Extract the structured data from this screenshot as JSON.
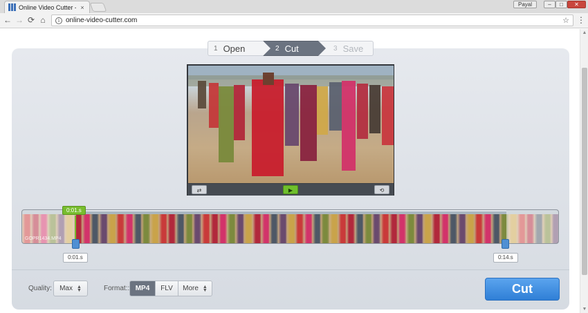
{
  "browser": {
    "tab_title": "Online Video Cutter - Cu",
    "tab_close": "×",
    "user_name": "Payal",
    "window_minimize": "–",
    "window_maximize": "□",
    "window_close": "✕",
    "url": "online-video-cutter.com",
    "icons": {
      "back": "←",
      "forward": "→",
      "reload": "⟳",
      "home": "⌂",
      "info": "i",
      "star": "☆",
      "menu": "⋮"
    }
  },
  "stepper": {
    "steps": [
      {
        "num": "1",
        "label": "Open"
      },
      {
        "num": "2",
        "label": "Cut"
      },
      {
        "num": "3",
        "label": "Save"
      }
    ],
    "active_index": 1
  },
  "player": {
    "buttons": {
      "swap": "⇄",
      "play": "▶",
      "rotate": "⟲"
    }
  },
  "timeline": {
    "watermark": "GOPR1434.MP4",
    "current_time": "0:01.s",
    "start_time": "0:01.s",
    "end_time": "0:14.s",
    "frame_count": 21
  },
  "settings": {
    "quality_label": "Quality:",
    "quality_value": "Max",
    "format_label": "Format::",
    "formats": [
      "MP4",
      "FLV",
      "More"
    ],
    "active_format": "MP4"
  },
  "actions": {
    "cut_label": "Cut"
  },
  "colors": {
    "accent_blue": "#2f7fd6",
    "accent_green": "#78bd2e",
    "step_active": "#6b7380"
  }
}
